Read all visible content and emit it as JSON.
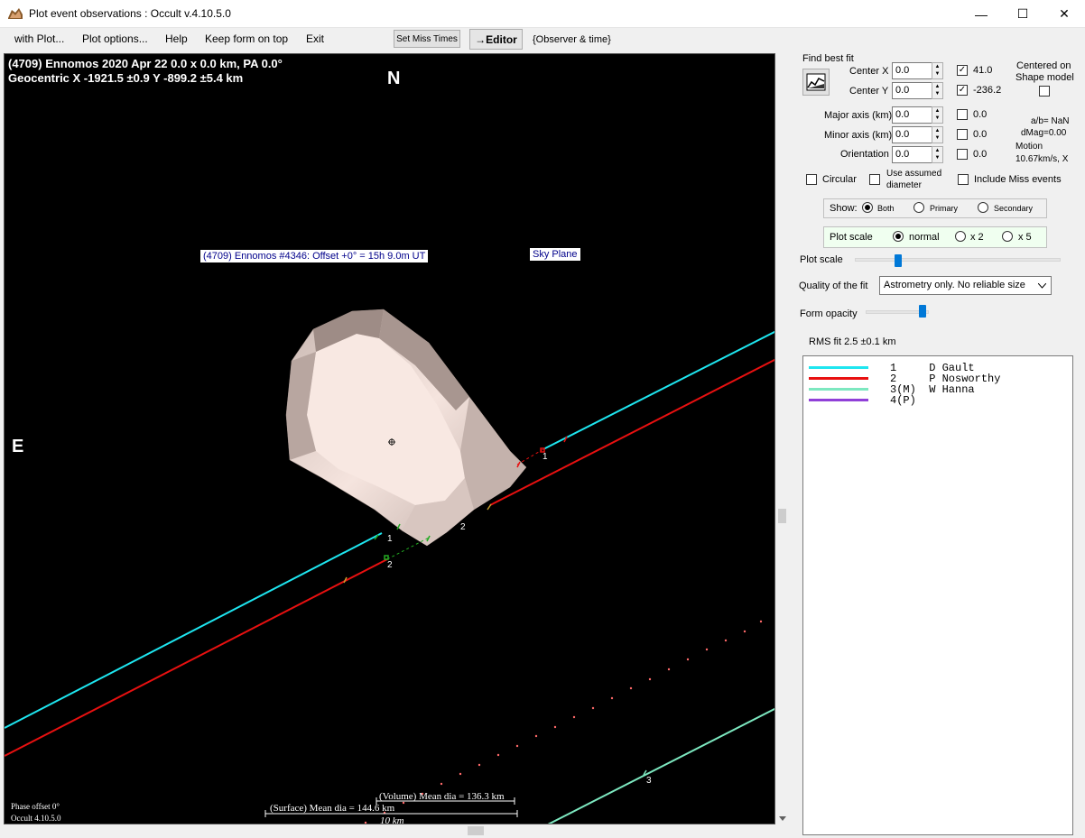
{
  "window": {
    "title": "Plot event observations : Occult v.4.10.5.0",
    "minimize_glyph": "—",
    "maximize_glyph": "☐",
    "close_glyph": "✕"
  },
  "menu": {
    "items": [
      "with Plot...",
      "Plot options...",
      "Help",
      "Keep form on top",
      "Exit"
    ],
    "set_miss_times": "Set Miss Times",
    "editor": "→Editor",
    "observer_time": "{Observer & time}"
  },
  "plot": {
    "header_line1": "(4709) Ennomos  2020 Apr 22  0.0 x 0.0 km, PA 0.0°",
    "header_line2": "Geocentric  X  -1921.5 ±0.9  Y -899.2 ±5.4 km",
    "north": "N",
    "east": "E",
    "shape_label": "(4709) Ennomos #4346: Offset +0° = 15h  9.0m UT",
    "sky_plane": "Sky Plane",
    "chord_labels": [
      "1",
      "2",
      "1",
      "2",
      "3"
    ],
    "volume_dia": "(Volume) Mean dia = 136.3 km",
    "surface_dia": "(Surface) Mean dia = 144.6 km",
    "scale_km": "10 km",
    "phase_offset": "Phase offset 0°",
    "version": "Occult 4.10.5.0",
    "colors": {
      "chord1": "#1ee6f0",
      "chord2": "#e81010",
      "chord3": "#7de8c0",
      "chord4": "#9040d8",
      "miss": "#ff6a6a"
    }
  },
  "panel": {
    "find_best_fit": "Find best fit",
    "fit_icon": "chart-fit-icon",
    "center_x_label": "Center X",
    "center_x_value": "0.0",
    "center_x_fit": "41.0",
    "center_y_label": "Center Y",
    "center_y_value": "0.0",
    "center_y_fit": "-236.2",
    "centered_on_line1": "Centered on",
    "centered_on_line2": "Shape model",
    "major_label": "Major axis (km)",
    "major_value": "0.0",
    "major_fit": "0.0",
    "minor_label": "Minor axis (km)",
    "minor_value": "0.0",
    "minor_fit": "0.0",
    "orient_label": "Orientation",
    "orient_value": "0.0",
    "orient_fit": "0.0",
    "ab": "a/b= NaN",
    "dmag": "dMag=0.00",
    "motion_label": "Motion",
    "motion_value": "10.67km/s, X",
    "circular": "Circular",
    "use_assumed_line1": "Use assumed",
    "use_assumed_line2": "diameter",
    "include_miss": "Include Miss events",
    "show_label": "Show:",
    "show_both": "Both",
    "show_primary": "Primary",
    "show_secondary": "Secondary",
    "plot_scale_group": "Plot scale",
    "scale_normal": "normal",
    "scale_x2": "x 2",
    "scale_x5": "x 5",
    "plot_scale_slider": "Plot scale",
    "plot_scale_level": 0.2,
    "quality_label": "Quality of the fit",
    "quality_value": "Astrometry only. No reliable size",
    "form_opacity": "Form opacity",
    "form_opacity_level": 0.9,
    "rms_fit": "RMS fit 2.5 ±0.1 km",
    "observers": [
      {
        "text": "1     D Gault",
        "color": "#1ee6f0"
      },
      {
        "text": "2     P Nosworthy",
        "color": "#e81010"
      },
      {
        "text": "3(M)  W Hanna",
        "color": "#7de8c0"
      },
      {
        "text": "4(P)",
        "color": "#9040d8"
      }
    ]
  }
}
